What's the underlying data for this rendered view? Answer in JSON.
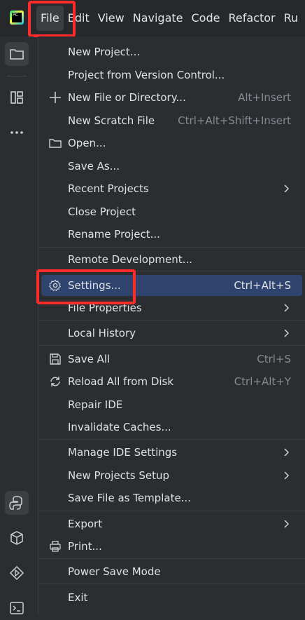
{
  "titlebar": {
    "logo_text": "PC",
    "menu": [
      "File",
      "Edit",
      "View",
      "Navigate",
      "Code",
      "Refactor",
      "Ru"
    ]
  },
  "toolstrip": {
    "icons": [
      "folder-icon",
      "structure-icon",
      "more-icon",
      "python-console-icon",
      "python-packages-icon",
      "services-icon",
      "terminal-icon"
    ]
  },
  "file_menu": {
    "items": [
      {
        "label": "New Project...",
        "shortcut": ""
      },
      {
        "label": "Project from Version Control...",
        "shortcut": ""
      },
      {
        "label": "New File or Directory...",
        "shortcut": "Alt+Insert"
      },
      {
        "label": "New Scratch File",
        "shortcut": "Ctrl+Alt+Shift+Insert"
      },
      {
        "label": "Open...",
        "shortcut": ""
      },
      {
        "label": "Save As...",
        "shortcut": ""
      },
      {
        "label": "Recent Projects",
        "shortcut": ""
      },
      {
        "label": "Close Project",
        "shortcut": ""
      },
      {
        "label": "Rename Project...",
        "shortcut": ""
      },
      {
        "label": "Remote Development...",
        "shortcut": ""
      },
      {
        "label": "Settings...",
        "shortcut": "Ctrl+Alt+S"
      },
      {
        "label": "File Properties",
        "shortcut": ""
      },
      {
        "label": "Local History",
        "shortcut": ""
      },
      {
        "label": "Save All",
        "shortcut": "Ctrl+S"
      },
      {
        "label": "Reload All from Disk",
        "shortcut": "Ctrl+Alt+Y"
      },
      {
        "label": "Repair IDE",
        "shortcut": ""
      },
      {
        "label": "Invalidate Caches...",
        "shortcut": ""
      },
      {
        "label": "Manage IDE Settings",
        "shortcut": ""
      },
      {
        "label": "New Projects Setup",
        "shortcut": ""
      },
      {
        "label": "Save File as Template...",
        "shortcut": ""
      },
      {
        "label": "Export",
        "shortcut": ""
      },
      {
        "label": "Print...",
        "shortcut": ""
      },
      {
        "label": "Power Save Mode",
        "shortcut": ""
      },
      {
        "label": "Exit",
        "shortcut": ""
      }
    ]
  },
  "colors": {
    "accent_selection": "#2e436e",
    "highlight_annotation": "#ff2a2a"
  }
}
